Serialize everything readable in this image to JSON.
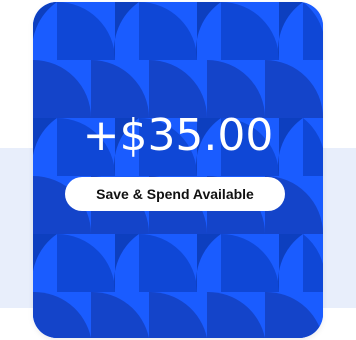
{
  "card": {
    "amount": "+$35.00",
    "badge_label": "Save & Spend Available"
  },
  "colors": {
    "card_background": "#1a5cff",
    "pattern_dark": "#0d3fbf",
    "pattern_mid": "#0f47d6",
    "badge_background": "#ffffff",
    "amount_text": "#ffffff",
    "page_band": "#e8eefb"
  }
}
